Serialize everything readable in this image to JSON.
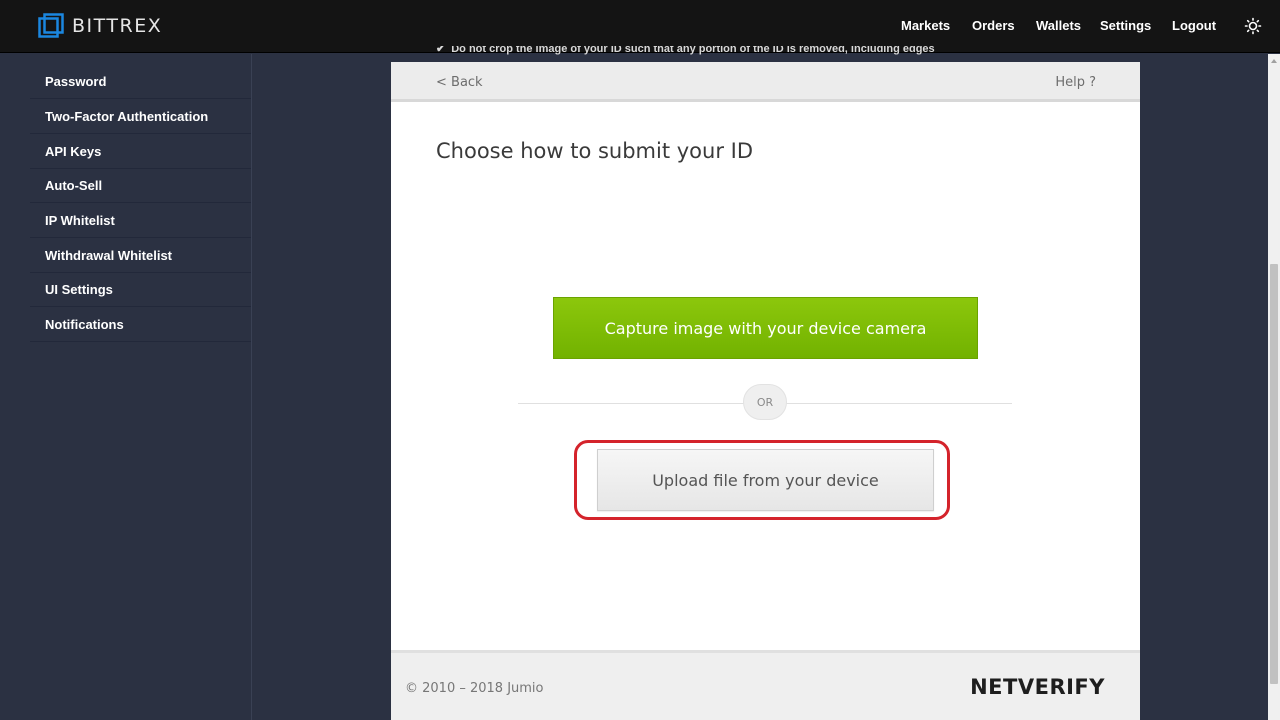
{
  "brand": {
    "name": "BITTREX",
    "logo_icon": "bittrex-logo-icon",
    "accent": "#1b87e0"
  },
  "nav": {
    "items": [
      "Markets",
      "Orders",
      "Wallets",
      "Settings",
      "Logout"
    ],
    "theme_icon": "sun-icon"
  },
  "sidebar": {
    "items": [
      {
        "label": "Password"
      },
      {
        "label": "Two-Factor Authentication"
      },
      {
        "label": "API Keys"
      },
      {
        "label": "Auto-Sell"
      },
      {
        "label": "IP Whitelist"
      },
      {
        "label": "Withdrawal Whitelist"
      },
      {
        "label": "UI Settings"
      },
      {
        "label": "Notifications"
      }
    ]
  },
  "background_note": {
    "icon": "check-icon",
    "text": "Do not crop the image of your ID such that any portion of the ID is removed, including edges"
  },
  "panel": {
    "back_label": "< Back",
    "help_label": "Help ?",
    "title": "Choose how to submit your ID",
    "camera_button": "Capture image with your device camera",
    "or_label": "OR",
    "upload_button": "Upload file from your device",
    "copyright": "© 2010 – 2018 Jumio",
    "footer_logo": "NETVERIFY",
    "camera_color": "#82be00",
    "highlight_color": "#d4232b"
  }
}
